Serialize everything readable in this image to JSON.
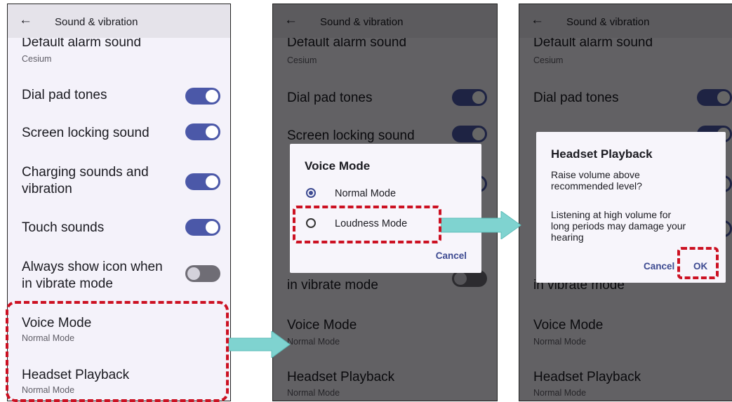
{
  "header": {
    "title": "Sound & vibration"
  },
  "settings": {
    "default_alarm": {
      "title": "Default alarm sound",
      "value": "Cesium"
    },
    "dial_pad": {
      "title": "Dial pad tones"
    },
    "screen_locking": {
      "title": "Screen locking sound"
    },
    "charging_line1": "Charging sounds and",
    "charging_line2": "vibration",
    "touch_sounds": {
      "title": "Touch sounds"
    },
    "vibrate_icon_line1": "Always show icon when",
    "vibrate_icon_line2": "in vibrate mode",
    "voice_mode": {
      "title": "Voice Mode",
      "value": "Normal Mode"
    },
    "headset_playback": {
      "title": "Headset Playback",
      "value": "Normal Mode"
    }
  },
  "voice_mode_dialog": {
    "title": "Voice Mode",
    "options": [
      {
        "label": "Normal Mode",
        "selected": true
      },
      {
        "label": "Loudness Mode",
        "selected": false
      }
    ],
    "cancel_label": "Cancel"
  },
  "headset_dialog": {
    "title": "Headset Playback",
    "line1": "Raise volume above",
    "line2": "recommended level?",
    "line3": "Listening at high volume for",
    "line4": "long periods may damage your",
    "line5": "hearing",
    "cancel_label": "Cancel",
    "ok_label": "OK"
  },
  "colors": {
    "toggle_on": "#4b58a8",
    "toggle_off": "#6f6d75",
    "highlight": "#cc1122",
    "arrow": "#7fd3d0",
    "accent": "#3d4a91"
  }
}
